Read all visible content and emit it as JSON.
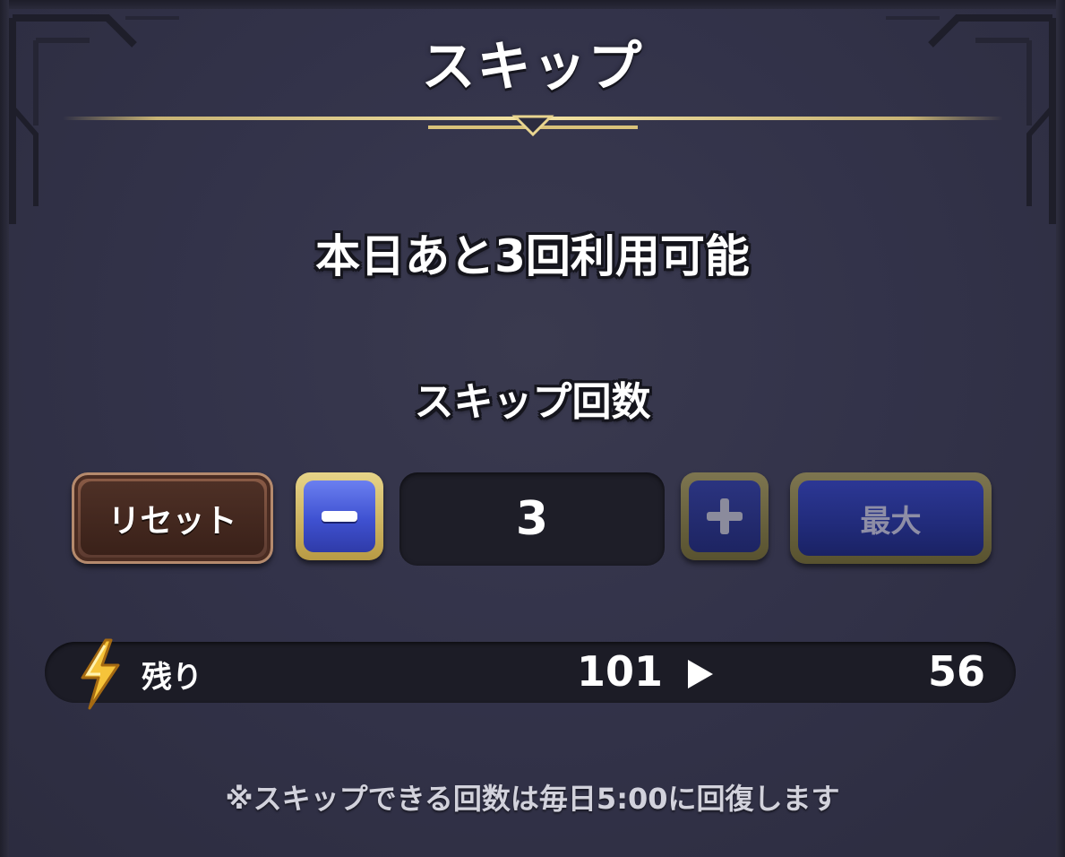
{
  "dialog": {
    "title": "スキップ",
    "availability_text": "本日あと3回利用可能",
    "count_label": "スキップ回数"
  },
  "controls": {
    "reset_label": "リセット",
    "count_value": "3",
    "max_label": "最大",
    "minus_icon": "minus-icon",
    "plus_icon": "plus-icon"
  },
  "stamina": {
    "icon": "lightning-bolt-icon",
    "label": "残り",
    "current": "101",
    "after": "56",
    "arrow_icon": "right-triangle-arrow-icon"
  },
  "note": "※スキップできる回数は毎日5:00に回復します",
  "colors": {
    "background": "#33334a",
    "gold_trim": "#d9c27a",
    "button_blue": "#3f51d1",
    "reset_brown": "#4e3026",
    "count_box": "#1e1e28"
  }
}
